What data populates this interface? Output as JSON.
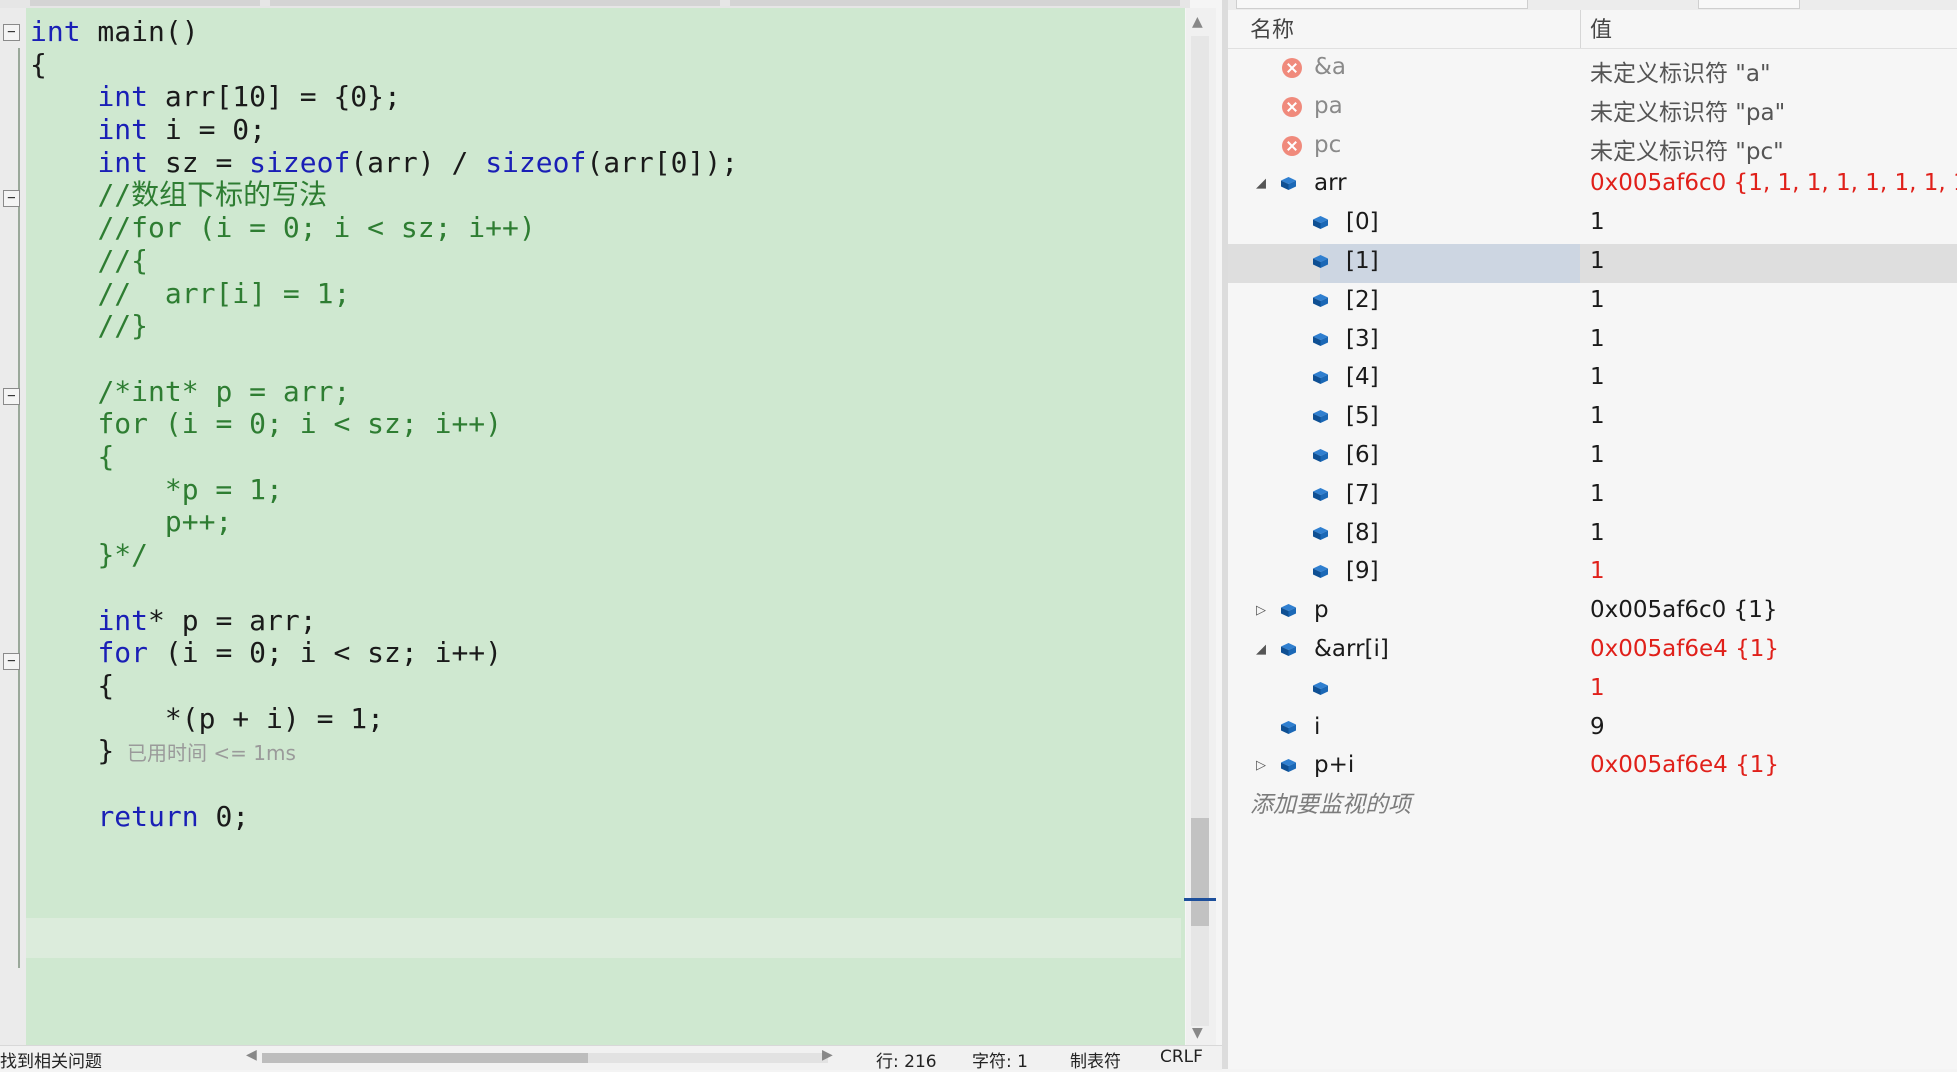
{
  "editor": {
    "lines": [
      {
        "segments": [
          {
            "t": "int",
            "c": "kw"
          },
          {
            "t": " main()"
          }
        ]
      },
      {
        "segments": [
          {
            "t": "{"
          }
        ]
      },
      {
        "segments": [
          {
            "t": "    "
          },
          {
            "t": "int",
            "c": "kw"
          },
          {
            "t": " arr[10] = {0};"
          }
        ]
      },
      {
        "segments": [
          {
            "t": "    "
          },
          {
            "t": "int",
            "c": "kw"
          },
          {
            "t": " i = 0;"
          }
        ]
      },
      {
        "segments": [
          {
            "t": "    "
          },
          {
            "t": "int",
            "c": "kw"
          },
          {
            "t": " sz = "
          },
          {
            "t": "sizeof",
            "c": "kw"
          },
          {
            "t": "(arr) / "
          },
          {
            "t": "sizeof",
            "c": "kw"
          },
          {
            "t": "(arr[0]);"
          }
        ]
      },
      {
        "segments": [
          {
            "t": "    "
          },
          {
            "t": "//数组下标的写法",
            "c": "cm"
          }
        ]
      },
      {
        "segments": [
          {
            "t": "    "
          },
          {
            "t": "//for (i = 0; i < sz; i++)",
            "c": "cm"
          }
        ]
      },
      {
        "segments": [
          {
            "t": "    "
          },
          {
            "t": "//{",
            "c": "cm"
          }
        ]
      },
      {
        "segments": [
          {
            "t": "    "
          },
          {
            "t": "//  arr[i] = 1;",
            "c": "cm"
          }
        ]
      },
      {
        "segments": [
          {
            "t": "    "
          },
          {
            "t": "//}",
            "c": "cm"
          }
        ]
      },
      {
        "segments": [
          {
            "t": ""
          }
        ]
      },
      {
        "segments": [
          {
            "t": "    "
          },
          {
            "t": "/*int* p = arr;",
            "c": "cm"
          }
        ]
      },
      {
        "segments": [
          {
            "t": "    "
          },
          {
            "t": "for (i = 0; i < sz; i++)",
            "c": "cm"
          }
        ]
      },
      {
        "segments": [
          {
            "t": "    "
          },
          {
            "t": "{",
            "c": "cm"
          }
        ]
      },
      {
        "segments": [
          {
            "t": "        "
          },
          {
            "t": "*p = 1;",
            "c": "cm"
          }
        ]
      },
      {
        "segments": [
          {
            "t": "        "
          },
          {
            "t": "p++;",
            "c": "cm"
          }
        ]
      },
      {
        "segments": [
          {
            "t": "    "
          },
          {
            "t": "}*/",
            "c": "cm"
          }
        ]
      },
      {
        "segments": [
          {
            "t": ""
          }
        ]
      },
      {
        "segments": [
          {
            "t": "    "
          },
          {
            "t": "int",
            "c": "kw"
          },
          {
            "t": "* p = arr;"
          }
        ]
      },
      {
        "segments": [
          {
            "t": "    "
          },
          {
            "t": "for",
            "c": "kw"
          },
          {
            "t": " (i = 0; i < sz; i++)"
          }
        ]
      },
      {
        "segments": [
          {
            "t": "    {"
          }
        ]
      },
      {
        "segments": [
          {
            "t": "        *(p + i) = 1;"
          }
        ]
      },
      {
        "segments": [
          {
            "t": "    }"
          },
          {
            "t": "  已用时间 <= 1ms",
            "c": "hint"
          }
        ]
      },
      {
        "segments": [
          {
            "t": ""
          }
        ]
      },
      {
        "segments": [
          {
            "t": "    "
          },
          {
            "t": "return",
            "c": "kw"
          },
          {
            "t": " 0;"
          }
        ]
      }
    ],
    "fold_markers": [
      "−",
      "−",
      "−",
      "−"
    ]
  },
  "status_bar": {
    "issues": "找到相关问题",
    "line": "行: 216",
    "char": "字符: 1",
    "tabs": "制表符",
    "eol": "CRLF"
  },
  "watch": {
    "header_name": "名称",
    "header_value": "值",
    "rows": [
      {
        "name": "&a",
        "value": "未定义标识符 \"a\"",
        "icon": "error-icon",
        "state": "plain",
        "indent": 0,
        "expander": ""
      },
      {
        "name": "pa",
        "value": "未定义标识符 \"pa\"",
        "icon": "error-icon",
        "state": "plain",
        "indent": 0,
        "expander": ""
      },
      {
        "name": "pc",
        "value": "未定义标识符 \"pc\"",
        "icon": "error-icon",
        "state": "plain",
        "indent": 0,
        "expander": ""
      },
      {
        "name": "arr",
        "value": "0x005af6c0 {1, 1, 1, 1, 1, 1, 1, 1, 1",
        "icon": "variable-icon",
        "state": "changed",
        "indent": 0,
        "expander": "◢"
      },
      {
        "name": "[0]",
        "value": "1",
        "icon": "variable-icon",
        "state": "normal",
        "indent": 1,
        "expander": ""
      },
      {
        "name": "[1]",
        "value": "1",
        "icon": "variable-icon",
        "state": "normal",
        "indent": 1,
        "expander": "",
        "selected": true
      },
      {
        "name": "[2]",
        "value": "1",
        "icon": "variable-icon",
        "state": "normal",
        "indent": 1,
        "expander": ""
      },
      {
        "name": "[3]",
        "value": "1",
        "icon": "variable-icon",
        "state": "normal",
        "indent": 1,
        "expander": ""
      },
      {
        "name": "[4]",
        "value": "1",
        "icon": "variable-icon",
        "state": "normal",
        "indent": 1,
        "expander": ""
      },
      {
        "name": "[5]",
        "value": "1",
        "icon": "variable-icon",
        "state": "normal",
        "indent": 1,
        "expander": ""
      },
      {
        "name": "[6]",
        "value": "1",
        "icon": "variable-icon",
        "state": "normal",
        "indent": 1,
        "expander": ""
      },
      {
        "name": "[7]",
        "value": "1",
        "icon": "variable-icon",
        "state": "normal",
        "indent": 1,
        "expander": ""
      },
      {
        "name": "[8]",
        "value": "1",
        "icon": "variable-icon",
        "state": "normal",
        "indent": 1,
        "expander": ""
      },
      {
        "name": "[9]",
        "value": "1",
        "icon": "variable-icon",
        "state": "changed",
        "indent": 1,
        "expander": ""
      },
      {
        "name": "p",
        "value": "0x005af6c0 {1}",
        "icon": "variable-icon",
        "state": "normal",
        "indent": 0,
        "expander": "▷"
      },
      {
        "name": "&arr[i]",
        "value": "0x005af6e4 {1}",
        "icon": "variable-icon",
        "state": "changed",
        "indent": 0,
        "expander": "◢"
      },
      {
        "name": "",
        "value": "1",
        "icon": "variable-icon",
        "state": "changed",
        "indent": 1,
        "expander": ""
      },
      {
        "name": "i",
        "value": "9",
        "icon": "variable-icon",
        "state": "normal",
        "indent": 0,
        "expander": ""
      },
      {
        "name": "p+i",
        "value": "0x005af6e4 {1}",
        "icon": "variable-icon",
        "state": "changed",
        "indent": 0,
        "expander": "▷"
      }
    ],
    "add_watch": "添加要监视的项"
  }
}
